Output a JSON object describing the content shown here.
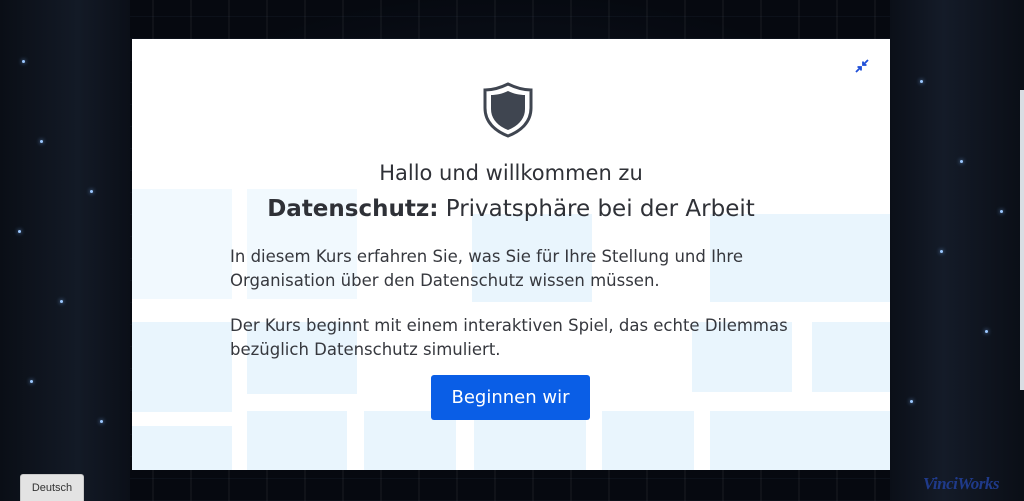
{
  "dialog": {
    "greeting": "Hallo und willkommen zu",
    "title_bold": "Datenschutz:",
    "title_rest": " Privatsphäre bei der Arbeit",
    "paragraph1": "In diesem Kurs erfahren Sie, was Sie für Ihre Stellung und Ihre Organisation über den Datenschutz wissen müssen.",
    "paragraph2": "Der Kurs beginnt mit einem interaktiven Spiel, das echte Dilemmas bezüglich Datenschutz simuliert.",
    "start_label": "Beginnen wir",
    "shrink_icon": "collapse-arrows-icon",
    "header_icon": "shield-icon"
  },
  "footer": {
    "language_label": "Deutsch",
    "brand": "VinciWorks"
  },
  "colors": {
    "accent": "#0a5ee6",
    "text": "#2f3137",
    "tile": "#e9f5fd"
  }
}
